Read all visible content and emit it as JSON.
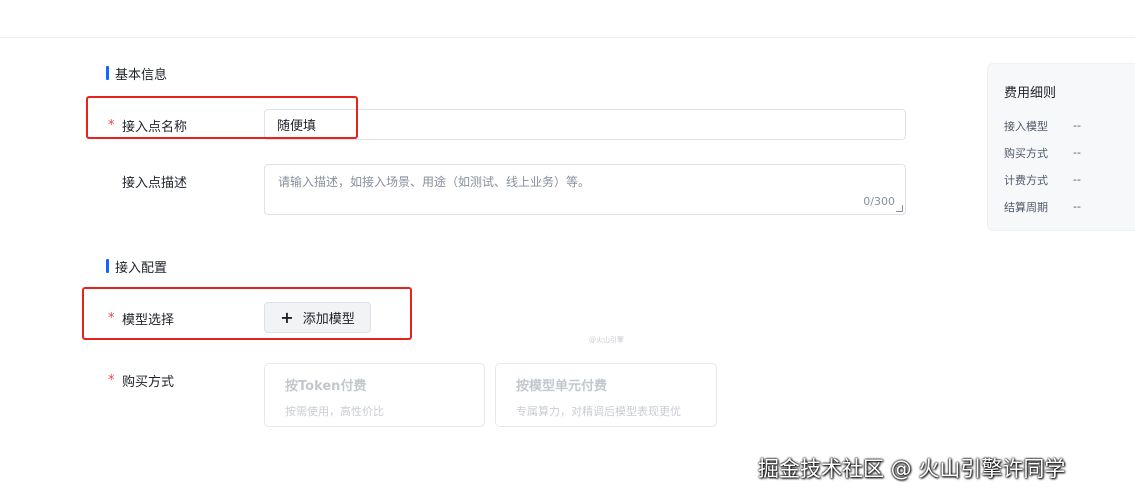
{
  "basic_info": {
    "section_title": "基本信息",
    "endpoint_name": {
      "required_mark": "*",
      "label": "接入点名称",
      "value": "随便填"
    },
    "endpoint_desc": {
      "label": "接入点描述",
      "placeholder": "请输入描述，如接入场景、用途（如测试、线上业务）等。",
      "counter": "0/300"
    }
  },
  "access_config": {
    "section_title": "接入配置",
    "model_select": {
      "required_mark": "*",
      "label": "模型选择",
      "button_icon": "plus-icon",
      "button_label": "添加模型"
    },
    "purchase_method": {
      "required_mark": "*",
      "label": "购买方式",
      "options": [
        {
          "title": "按Token付费",
          "desc": "按需使用，高性价比"
        },
        {
          "title": "按模型单元付费",
          "desc": "专属算力，对精调后模型表现更优"
        }
      ]
    },
    "faint_mark": "@火山引擎"
  },
  "fee_details": {
    "title": "费用细则",
    "rows": [
      {
        "key": "接入模型",
        "value": "--"
      },
      {
        "key": "购买方式",
        "value": "--"
      },
      {
        "key": "计费方式",
        "value": "--"
      },
      {
        "key": "结算周期",
        "value": "--"
      }
    ]
  },
  "annotation_color": "#e8231b",
  "accent_color": "#1664ff",
  "watermark": "掘金技术社区 @ 火山引擎许同学"
}
